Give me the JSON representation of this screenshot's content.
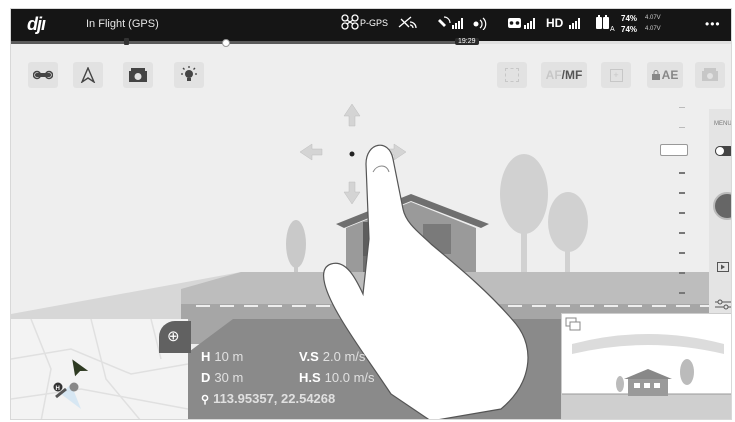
{
  "topbar": {
    "logo": "djı",
    "flight_status": "In Flight (GPS)",
    "gps_mode": "P-GPS",
    "hd_label": "HD",
    "battery": {
      "pct_top": "74%",
      "volt_top": "4.07V",
      "pct_bottom": "74%",
      "volt_bottom": "4.07V"
    },
    "more": "•••"
  },
  "timeline": {
    "time": "19:29"
  },
  "toolbar": {
    "af_label": "AF",
    "mf_label": "/MF",
    "ae_label": "AE"
  },
  "right_panel": {
    "menu_label": "MENU"
  },
  "telemetry": {
    "h_label": "H",
    "h_value": "10 m",
    "vs_label": "V.S",
    "vs_value": "2.0 m/s",
    "d_label": "D",
    "d_value": "30 m",
    "hs_label": "H.S",
    "hs_value": "10.0 m/s",
    "coordinates": "113.95357, 22.54268"
  },
  "map": {
    "home_marker": "H"
  },
  "colors": {
    "topbar_bg": "#151515",
    "scene_bg": "#eeeeee",
    "road": "#a6a6a6",
    "telemetry_bg": "#8a8a8a"
  },
  "icons": [
    "drone-icon",
    "satellite-icon",
    "remote-controller-icon",
    "battery-icon",
    "camera-settings-icon",
    "ae-lock-icon",
    "camera-icon",
    "target-icon",
    "playback-icon",
    "settings-sliders-icon",
    "arrow-up-icon",
    "arrow-down-icon",
    "arrow-left-icon",
    "arrow-right-icon",
    "location-pin-icon"
  ]
}
